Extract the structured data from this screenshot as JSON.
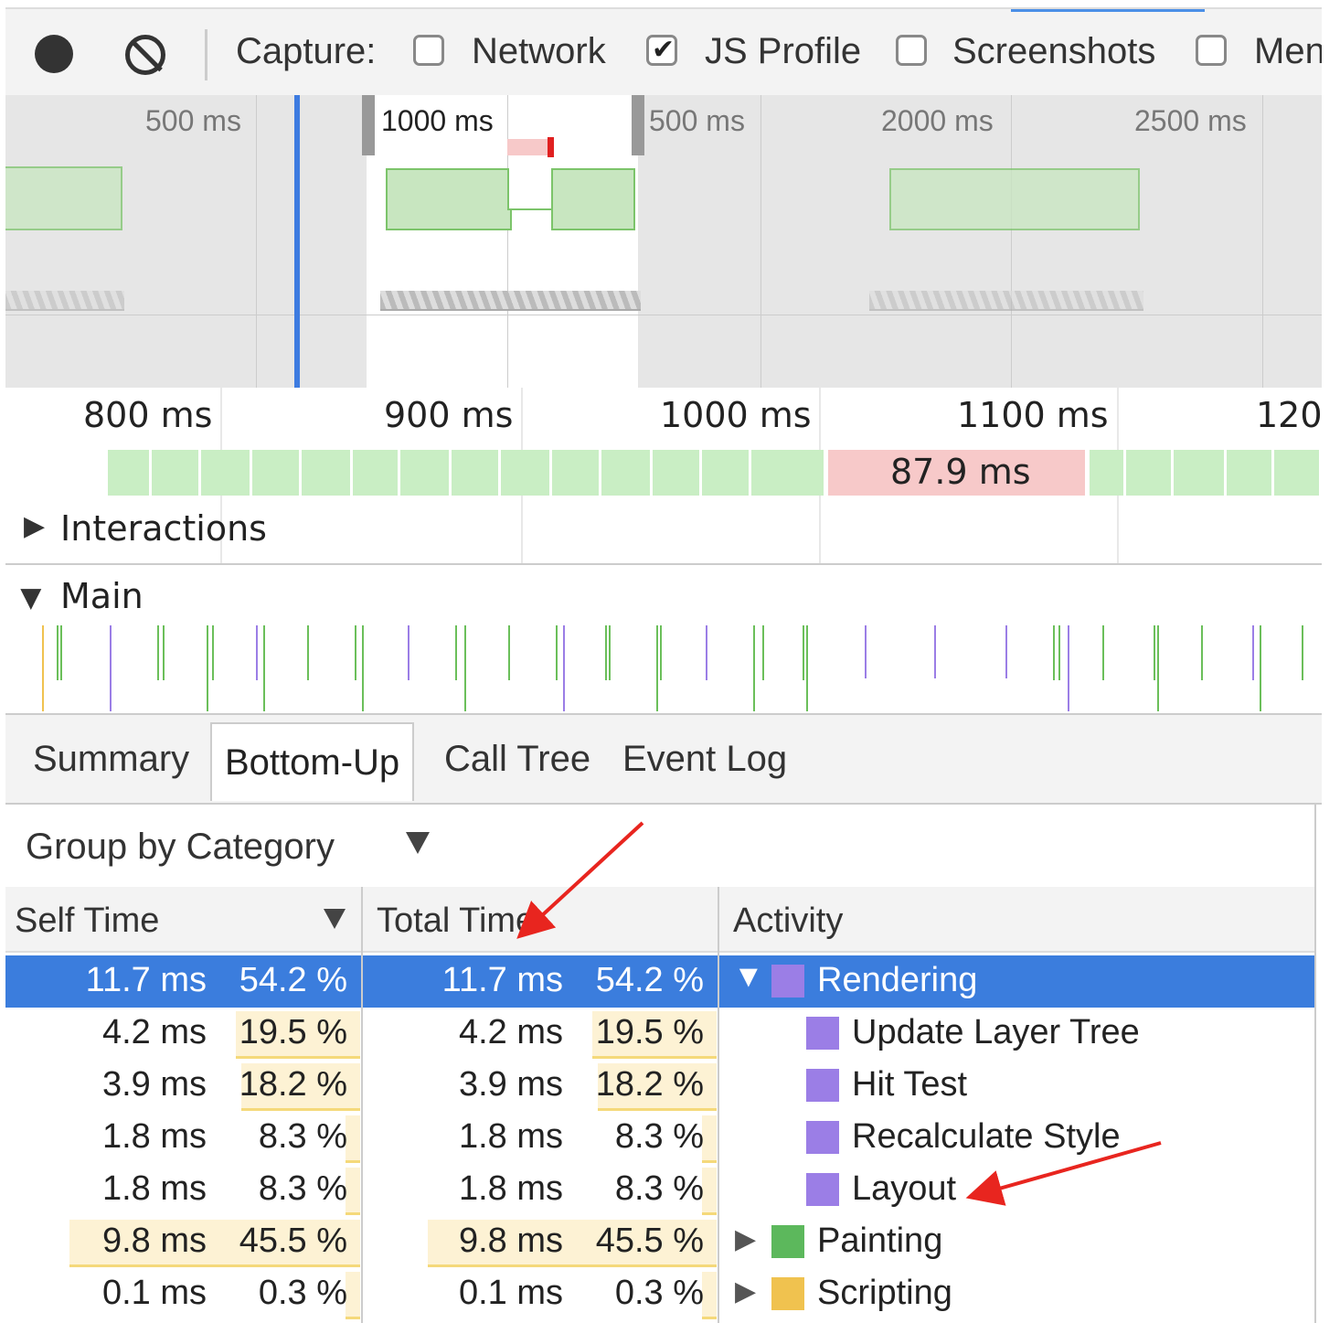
{
  "toolbar": {
    "capture_label": "Capture:",
    "options": [
      {
        "label": "Network",
        "checked": false
      },
      {
        "label": "JS Profile",
        "checked": true
      },
      {
        "label": "Screenshots",
        "checked": false
      },
      {
        "label": "Men",
        "checked": false
      }
    ]
  },
  "overview": {
    "labels": [
      "500 ms",
      "1000 ms",
      "500 ms",
      "2000 ms",
      "2500 ms"
    ]
  },
  "ruler": {
    "labels": [
      "800 ms",
      "900 ms",
      "1000 ms",
      "1100 ms",
      "120"
    ],
    "slow_frame_label": "87.9 ms"
  },
  "tracks": {
    "interactions": "Interactions",
    "main": "Main"
  },
  "tabs": [
    "Summary",
    "Bottom-Up",
    "Call Tree",
    "Event Log"
  ],
  "groupby": {
    "label": "Group by Category"
  },
  "grid": {
    "headers": {
      "self": "Self Time",
      "total": "Total Time",
      "activity": "Activity"
    },
    "rows": [
      {
        "self_ms": "11.7 ms",
        "self_pct": "54.2 %",
        "total_ms": "11.7 ms",
        "total_pct": "54.2 %",
        "activity": "Rendering",
        "color": "#9b7ee6",
        "expander": "open",
        "indent": 0,
        "selected": true
      },
      {
        "self_ms": "4.2 ms",
        "self_pct": "19.5 %",
        "total_ms": "4.2 ms",
        "total_pct": "19.5 %",
        "activity": "Update Layer Tree",
        "color": "#9b7ee6",
        "expander": "none",
        "indent": 1,
        "selected": false
      },
      {
        "self_ms": "3.9 ms",
        "self_pct": "18.2 %",
        "total_ms": "3.9 ms",
        "total_pct": "18.2 %",
        "activity": "Hit Test",
        "color": "#9b7ee6",
        "expander": "none",
        "indent": 1,
        "selected": false
      },
      {
        "self_ms": "1.8 ms",
        "self_pct": "8.3 %",
        "total_ms": "1.8 ms",
        "total_pct": "8.3 %",
        "activity": "Recalculate Style",
        "color": "#9b7ee6",
        "expander": "none",
        "indent": 1,
        "selected": false
      },
      {
        "self_ms": "1.8 ms",
        "self_pct": "8.3 %",
        "total_ms": "1.8 ms",
        "total_pct": "8.3 %",
        "activity": "Layout",
        "color": "#9b7ee6",
        "expander": "none",
        "indent": 1,
        "selected": false
      },
      {
        "self_ms": "9.8 ms",
        "self_pct": "45.5 %",
        "total_ms": "9.8 ms",
        "total_pct": "45.5 %",
        "activity": "Painting",
        "color": "#5cb85c",
        "expander": "closed",
        "indent": 0,
        "selected": false
      },
      {
        "self_ms": "0.1 ms",
        "self_pct": "0.3 %",
        "total_ms": "0.1 ms",
        "total_pct": "0.3 %",
        "activity": "Scripting",
        "color": "#f0c24f",
        "expander": "closed",
        "indent": 0,
        "selected": false
      }
    ]
  },
  "colors": {
    "accent": "#3b7ddd",
    "rendering": "#9b7ee6",
    "painting": "#5cb85c",
    "scripting": "#f0c24f",
    "annotation": "#e8251f"
  }
}
